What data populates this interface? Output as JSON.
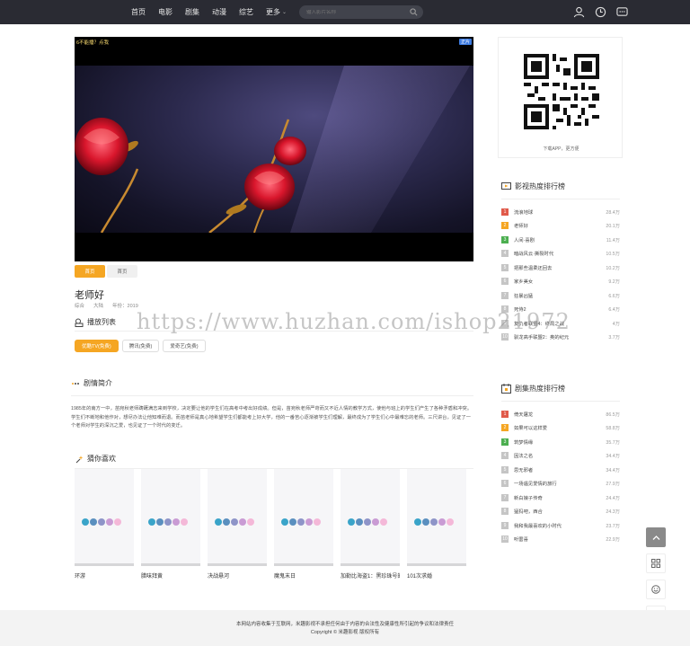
{
  "nav": {
    "items": [
      "首页",
      "电影",
      "剧集",
      "动漫",
      "综艺",
      "更多"
    ],
    "search_placeholder": "输入影片名称"
  },
  "player": {
    "top_text": "6不能播？点我",
    "badge": "正片"
  },
  "sources": [
    "首页",
    "首页"
  ],
  "video": {
    "title": "老师好",
    "meta": [
      "综合",
      "大陆",
      "年份：2019"
    ]
  },
  "playlist": {
    "title": "播放列表",
    "episodes": [
      "优酷TV(免费)",
      "腾讯(免费)",
      "爱奇艺(免费)"
    ]
  },
  "intro": {
    "title": "剧情简介",
    "text": "1985年的南方一中，苗宛秋老师踌躇满志来到学校，决定要让他的学生们在高考中考出好成绩。但是，苗宛秋老师严苛而又不近人情的教学方式，使他与班上的学生们产生了各种矛盾和冲突。学生们不断地和他作对，想尽办法让他知难而退。而苗老师是真心地希望学生们都能考上好大学，他的一番苦心逐渐被学生们理解，最终成为了学生们心中最难忘的老师。三尺讲台，见证了一个老师对学生的深沉之爱，也见证了一个时代的变迁。"
  },
  "guess": {
    "title": "猜你喜欢",
    "items": [
      "环游",
      "腊味拜黄",
      "决战悬河",
      "魔鬼末日",
      "加勒比海盗1：黑珍珠号的诅咒",
      "101次求婚"
    ]
  },
  "qr": {
    "caption": "下载APP，更方便"
  },
  "movie_rank": {
    "title": "影视热度排行榜",
    "items": [
      {
        "name": "流浪地球",
        "val": "28.4万"
      },
      {
        "name": "老师好",
        "val": "20.1万"
      },
      {
        "name": "人间·喜剧",
        "val": "11.4万"
      },
      {
        "name": "暗战风云·撕裂时代",
        "val": "10.5万"
      },
      {
        "name": "把那些温柔还回去",
        "val": "10.2万"
      },
      {
        "name": "家乡美女",
        "val": "9.2万"
      },
      {
        "name": "狂暴凶猛",
        "val": "6.6万"
      },
      {
        "name": "死侍2",
        "val": "6.4万"
      },
      {
        "name": "复仇者联盟4：终局之战",
        "val": "4万"
      },
      {
        "name": "驯龙高手联盟2：奥的纪元",
        "val": "3.7万"
      }
    ]
  },
  "drama_rank": {
    "title": "剧集热度排行榜",
    "items": [
      {
        "name": "倚天屠龙",
        "val": "86.5万"
      },
      {
        "name": "如果可以这样爱",
        "val": "58.8万"
      },
      {
        "name": "筑梦情缘",
        "val": "35.7万"
      },
      {
        "name": "因法之名",
        "val": "34.4万"
      },
      {
        "name": "思无邪者",
        "val": "34.4万"
      },
      {
        "name": "一场遇见爱情的旅行",
        "val": "27.9万"
      },
      {
        "name": "新白娘子传奇",
        "val": "24.4万"
      },
      {
        "name": "猛犸吧，西合",
        "val": "24.3万"
      },
      {
        "name": "我和我最喜欢的小时代",
        "val": "23.7万"
      },
      {
        "name": "听雷喜",
        "val": "22.9万"
      }
    ]
  },
  "footer": {
    "line1": "本网站内容收集于互联网，米趣影视不承担任何由于内容的合法性及健康性所引起的争议和法律责任",
    "line2": "Copyright © 米趣影视 版权所有"
  },
  "watermark": "https://www.huzhan.com/ishop21972",
  "colors": {
    "accent": "#f5a623",
    "header_bg": "#2a2b33",
    "rank1": "#e05a4a",
    "rank2": "#f5a623",
    "rank3": "#4caf50"
  }
}
